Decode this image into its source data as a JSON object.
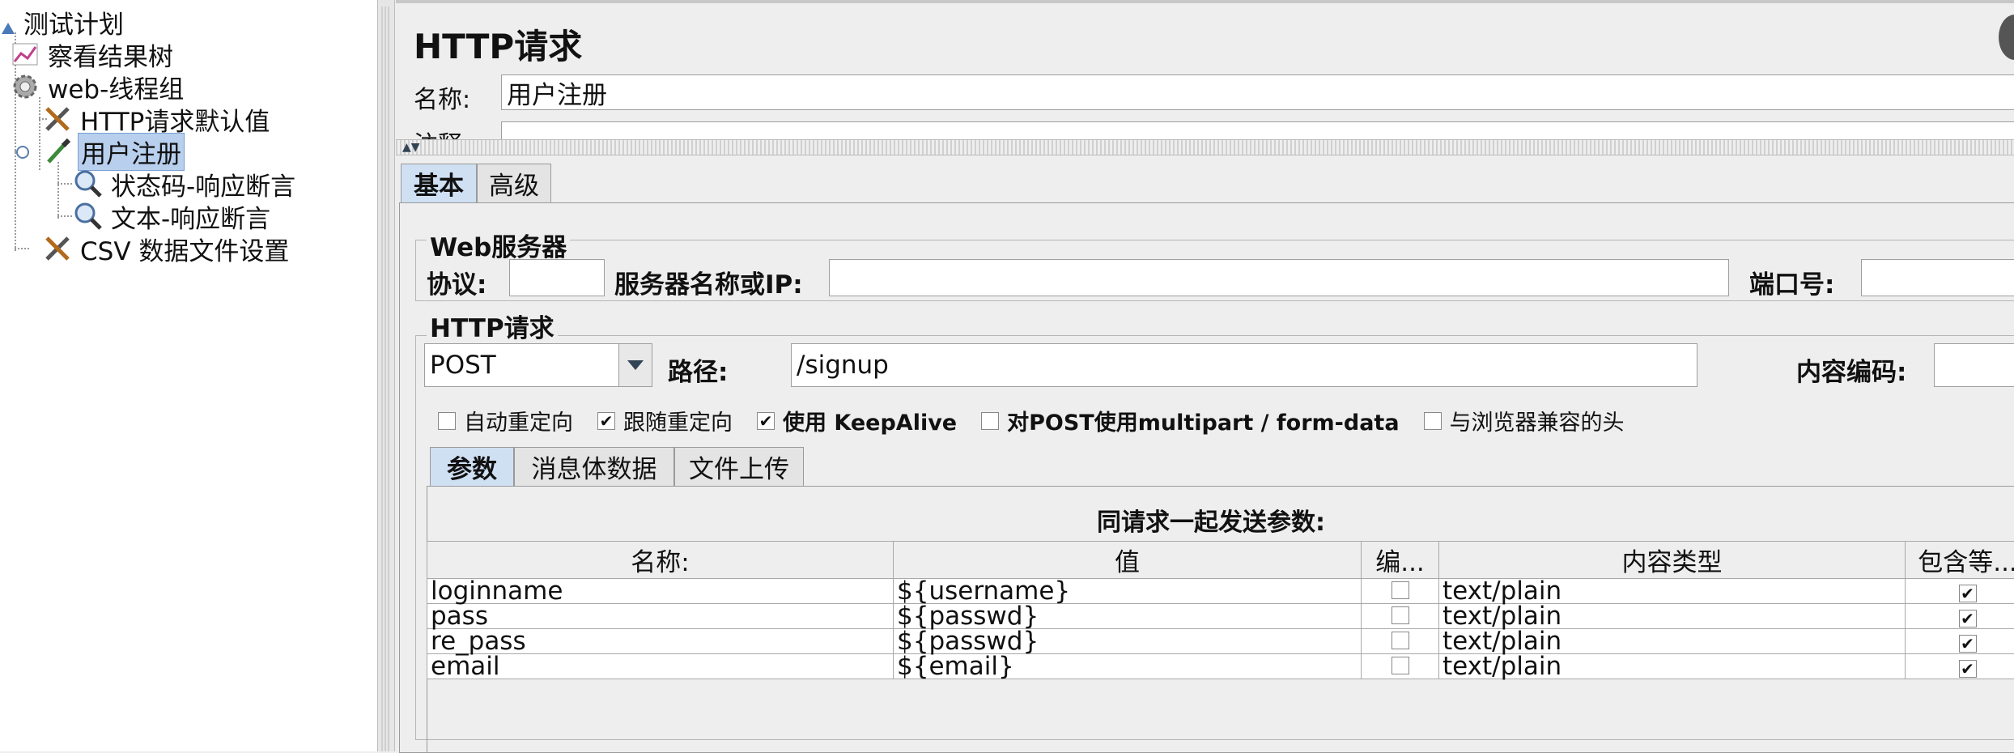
{
  "tree": {
    "root": "测试计划",
    "items": [
      {
        "label": "察看结果树",
        "icon": "chart-icon"
      },
      {
        "label": "web-线程组",
        "icon": "gear-icon"
      },
      {
        "label": "HTTP请求默认值",
        "icon": "tools-icon"
      },
      {
        "label": "用户注册",
        "icon": "pipette-icon",
        "selected": true
      },
      {
        "label": "状态码-响应断言",
        "icon": "magnifier-icon"
      },
      {
        "label": "文本-响应断言",
        "icon": "magnifier-icon"
      },
      {
        "label": "CSV 数据文件设置",
        "icon": "tools-icon"
      }
    ]
  },
  "panel": {
    "title": "HTTP请求",
    "name_label": "名称:",
    "name_value": "用户注册",
    "comment_label": "注释:",
    "tabs": [
      "基本",
      "高级"
    ],
    "web_server": {
      "legend": "Web服务器",
      "protocol_label": "协议:",
      "protocol_value": "",
      "server_label": "服务器名称或IP:",
      "server_value": "",
      "port_label": "端口号:",
      "port_value": ""
    },
    "http_request": {
      "legend": "HTTP请求",
      "method": "POST",
      "path_label": "路径:",
      "path_value": "/signup",
      "encoding_label": "内容编码:",
      "encoding_value": ""
    },
    "options": [
      {
        "label": "自动重定向",
        "checked": false
      },
      {
        "label": "跟随重定向",
        "checked": true
      },
      {
        "label": "使用 KeepAlive",
        "checked": true
      },
      {
        "label": "对POST使用multipart / form-data",
        "checked": false
      },
      {
        "label": "与浏览器兼容的头",
        "checked": false
      }
    ],
    "subtabs": [
      "参数",
      "消息体数据",
      "文件上传"
    ],
    "params": {
      "caption": "同请求一起发送参数:",
      "columns": [
        "名称:",
        "值",
        "编...",
        "内容类型",
        "包含等..."
      ],
      "rows": [
        {
          "name": "loginname",
          "value": "${username}",
          "encode": false,
          "content_type": "text/plain",
          "include_equals": true
        },
        {
          "name": "pass",
          "value": "${passwd}",
          "encode": false,
          "content_type": "text/plain",
          "include_equals": true
        },
        {
          "name": "re_pass",
          "value": "${passwd}",
          "encode": false,
          "content_type": "text/plain",
          "include_equals": true
        },
        {
          "name": "email",
          "value": "${email}",
          "encode": false,
          "content_type": "text/plain",
          "include_equals": true
        }
      ]
    }
  },
  "colors": {
    "selection": "#b8d0ee",
    "active_tab": "#cfe0f3",
    "background": "#eeeeee"
  }
}
